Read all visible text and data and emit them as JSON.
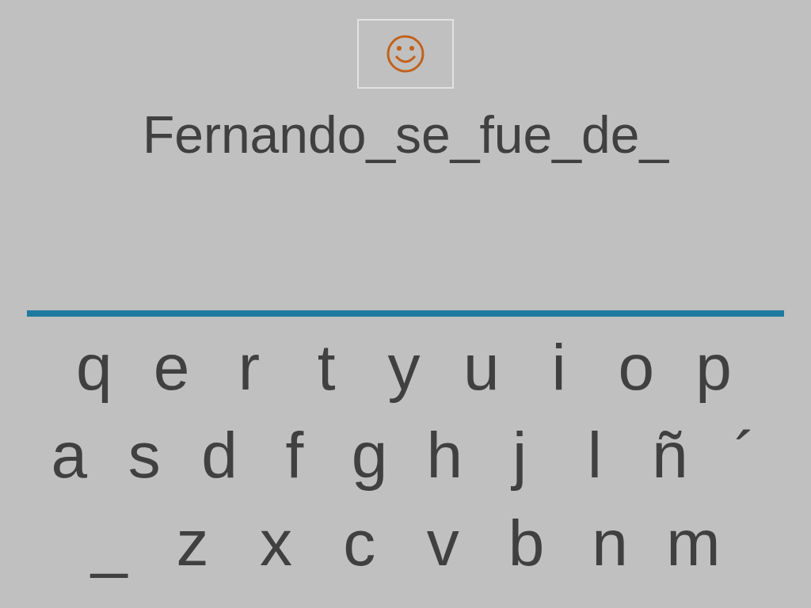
{
  "answer": {
    "text": "Fernando_se_fue_de_"
  },
  "keyboard": {
    "rows": [
      [
        "q",
        "e",
        "r",
        "t",
        "y",
        "u",
        "i",
        "o",
        "p"
      ],
      [
        "a",
        "s",
        "d",
        "f",
        "g",
        "h",
        "j",
        "l",
        "ñ",
        "´"
      ],
      [
        "_",
        "z",
        "x",
        "c",
        "v",
        "b",
        "n",
        "m"
      ]
    ]
  }
}
